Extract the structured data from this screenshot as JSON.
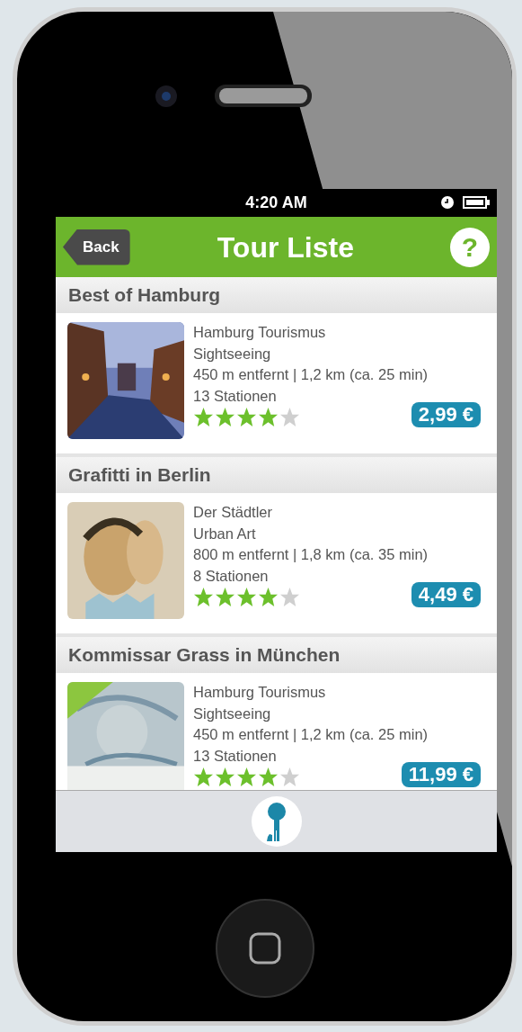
{
  "status_bar": {
    "time": "4:20 AM"
  },
  "header": {
    "back": "Back",
    "title": "Tour Liste",
    "help": "?"
  },
  "tours": [
    {
      "title": "Best of Hamburg",
      "author": "Hamburg Tourismus",
      "category": "Sightseeing",
      "distance": "450 m entfernt | 1,2 km (ca. 25 min)",
      "stations": "13 Stationen",
      "stars": 4,
      "price": "2,99 €"
    },
    {
      "title": "Grafitti in Berlin",
      "author": "Der Städtler",
      "category": "Urban Art",
      "distance": "800 m entfernt | 1,8 km (ca. 35 min)",
      "stations": "8 Stationen",
      "stars": 4,
      "price": "4,49 €"
    },
    {
      "title": "Kommissar Grass in München",
      "author": "Hamburg Tourismus",
      "category": "Sightseeing",
      "distance": "450 m entfernt | 1,2 km (ca. 25 min)",
      "stations": "13 Stationen",
      "stars": 4,
      "price": "11,99 €"
    }
  ]
}
